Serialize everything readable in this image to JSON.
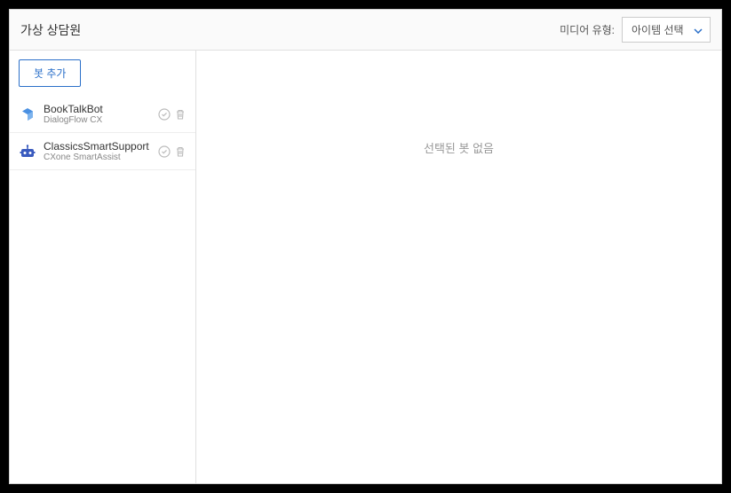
{
  "header": {
    "title": "가상 상담원",
    "media_label": "미디어 유형:",
    "media_select_value": "아이템 선택"
  },
  "sidebar": {
    "add_button_label": "봇 추가",
    "bots": [
      {
        "name": "BookTalkBot",
        "provider": "DialogFlow CX",
        "icon": "dialogflow"
      },
      {
        "name": "ClassicsSmartSupport",
        "provider": "CXone SmartAssist",
        "icon": "smartassist"
      }
    ]
  },
  "main": {
    "empty_message": "선택된 봇 없음"
  }
}
